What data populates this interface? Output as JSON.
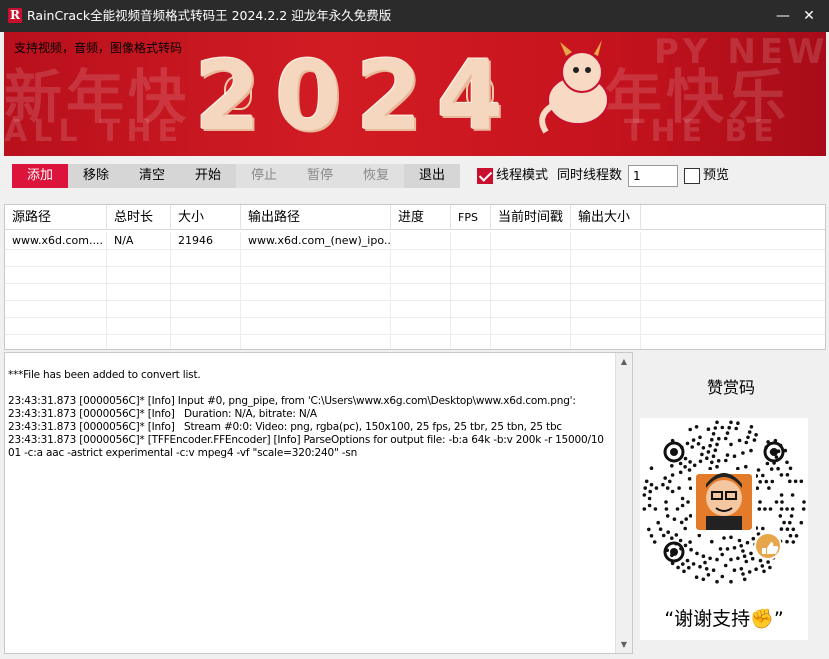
{
  "window": {
    "title": "RainCrack全能视频音频格式转码王 2024.2.2 迎龙年永久免费版",
    "logo_letter": "R",
    "minimize_glyph": "—",
    "close_glyph": "✕"
  },
  "banner": {
    "subtitle": "支持视频，音频，图像格式转码",
    "year": "2024",
    "bg_text_1": "新年快",
    "bg_text_2": "年快乐",
    "bg_text_3": "ALL THE",
    "bg_text_4": "THE BE",
    "bg_text_5": "PY NEW Y"
  },
  "toolbar": {
    "add_label": "添加",
    "remove_label": "移除",
    "clear_label": "清空",
    "start_label": "开始",
    "stop_label": "停止",
    "pause_label": "暂停",
    "resume_label": "恢复",
    "exit_label": "退出",
    "thread_mode_label": "线程模式",
    "thread_mode_checked": true,
    "threads_label": "同时线程数",
    "threads_value": "1",
    "preview_label": "预览",
    "preview_checked": false,
    "accent_color": "#dc143c"
  },
  "table": {
    "columns": [
      "源路径",
      "总时长",
      "大小",
      "输出路径",
      "进度",
      "FPS",
      "当前时间戳",
      "输出大小"
    ],
    "rows": [
      [
        "www.x6d.com....",
        "N/A",
        "21946",
        "www.x6d.com_(new)_ipo...",
        "",
        "",
        "",
        ""
      ]
    ]
  },
  "log": {
    "text": "***File has been added to convert list.\n\n23:43:31.873 [0000056C]* [Info] Input #0, png_pipe, from 'C:\\Users\\www.x6g.com\\Desktop\\www.x6d.com.png':\n23:43:31.873 [0000056C]* [Info]   Duration: N/A, bitrate: N/A\n23:43:31.873 [0000056C]* [Info]   Stream #0:0: Video: png, rgba(pc), 150x100, 25 fps, 25 tbr, 25 tbn, 25 tbc\n23:43:31.873 [0000056C]* [TFFEncoder.FFEncoder] [Info] ParseOptions for output file: -b:a 64k -b:v 200k -r 15000/1001 -c:a aac -astrict experimental -c:v mpeg4 -vf \"scale=320:240\" -sn"
  },
  "donate": {
    "title": "赞赏码",
    "thanks": "“谢谢支持✊”",
    "qr_icon": "qr-code-icon",
    "thumb_icon": "thumbs-up-icon"
  }
}
